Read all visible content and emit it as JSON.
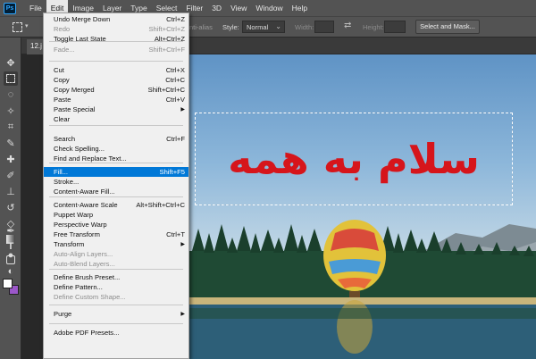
{
  "app": {
    "logo": "Ps"
  },
  "menubar": {
    "items": [
      "File",
      "Edit",
      "Image",
      "Layer",
      "Type",
      "Select",
      "Filter",
      "3D",
      "View",
      "Window",
      "Help"
    ],
    "active": "Edit"
  },
  "optionsbar": {
    "antialias_partial": "nti-alias",
    "style_label": "Style:",
    "style_value": "Normal",
    "width_label": "Width:",
    "height_label": "Height:",
    "select_mask_button": "Select and Mask..."
  },
  "document": {
    "tab_partial": "12.j"
  },
  "canvas": {
    "overlay_text": "سلام به همه"
  },
  "colors": {
    "foreground": "#ffffff",
    "background": "#9b57c9",
    "overlay_text": "#d6151b",
    "menu_highlight": "#0078d7"
  },
  "tools": [
    "move-icon",
    "rect-marquee-icon",
    "lasso-icon",
    "magic-wand-icon",
    "crop-icon",
    "eyedropper-icon",
    "healing-brush-icon",
    "brush-icon",
    "clone-stamp-icon",
    "history-brush-icon",
    "eraser-icon",
    "gradient-icon",
    "blur-icon",
    "dodge-icon",
    "pen-icon",
    "type-icon",
    "path-select-icon",
    "shape-icon",
    "hand-icon"
  ],
  "edit_menu": {
    "items": [
      {
        "label": "Undo Merge Down",
        "shortcut": "Ctrl+Z",
        "enabled": true
      },
      {
        "label": "Redo",
        "shortcut": "Shift+Ctrl+Z",
        "enabled": false
      },
      {
        "label": "Toggle Last State",
        "shortcut": "Alt+Ctrl+Z",
        "enabled": true
      },
      {
        "label": "Fade...",
        "shortcut": "Shift+Ctrl+F",
        "enabled": false
      },
      {
        "label": "Cut",
        "shortcut": "Ctrl+X",
        "enabled": true
      },
      {
        "label": "Copy",
        "shortcut": "Ctrl+C",
        "enabled": true
      },
      {
        "label": "Copy Merged",
        "shortcut": "Shift+Ctrl+C",
        "enabled": true
      },
      {
        "label": "Paste",
        "shortcut": "Ctrl+V",
        "enabled": true
      },
      {
        "label": "Paste Special",
        "shortcut": "",
        "enabled": true,
        "submenu": true
      },
      {
        "label": "Clear",
        "shortcut": "",
        "enabled": true
      },
      {
        "label": "Search",
        "shortcut": "Ctrl+F",
        "enabled": true
      },
      {
        "label": "Check Spelling...",
        "shortcut": "",
        "enabled": true
      },
      {
        "label": "Find and Replace Text...",
        "shortcut": "",
        "enabled": true
      },
      {
        "label": "Fill...",
        "shortcut": "Shift+F5",
        "enabled": true,
        "highlighted": true
      },
      {
        "label": "Stroke...",
        "shortcut": "",
        "enabled": true
      },
      {
        "label": "Content-Aware Fill...",
        "shortcut": "",
        "enabled": true
      },
      {
        "label": "Content-Aware Scale",
        "shortcut": "Alt+Shift+Ctrl+C",
        "enabled": true
      },
      {
        "label": "Puppet Warp",
        "shortcut": "",
        "enabled": true
      },
      {
        "label": "Perspective Warp",
        "shortcut": "",
        "enabled": true
      },
      {
        "label": "Free Transform",
        "shortcut": "Ctrl+T",
        "enabled": true
      },
      {
        "label": "Transform",
        "shortcut": "",
        "enabled": true,
        "submenu": true
      },
      {
        "label": "Auto-Align Layers...",
        "shortcut": "",
        "enabled": false
      },
      {
        "label": "Auto-Blend Layers...",
        "shortcut": "",
        "enabled": false
      },
      {
        "label": "Define Brush Preset...",
        "shortcut": "",
        "enabled": true
      },
      {
        "label": "Define Pattern...",
        "shortcut": "",
        "enabled": true
      },
      {
        "label": "Define Custom Shape...",
        "shortcut": "",
        "enabled": false
      },
      {
        "label": "Purge",
        "shortcut": "",
        "enabled": true,
        "submenu": true
      },
      {
        "label": "Adobe PDF Presets...",
        "shortcut": "",
        "enabled": true
      }
    ]
  }
}
